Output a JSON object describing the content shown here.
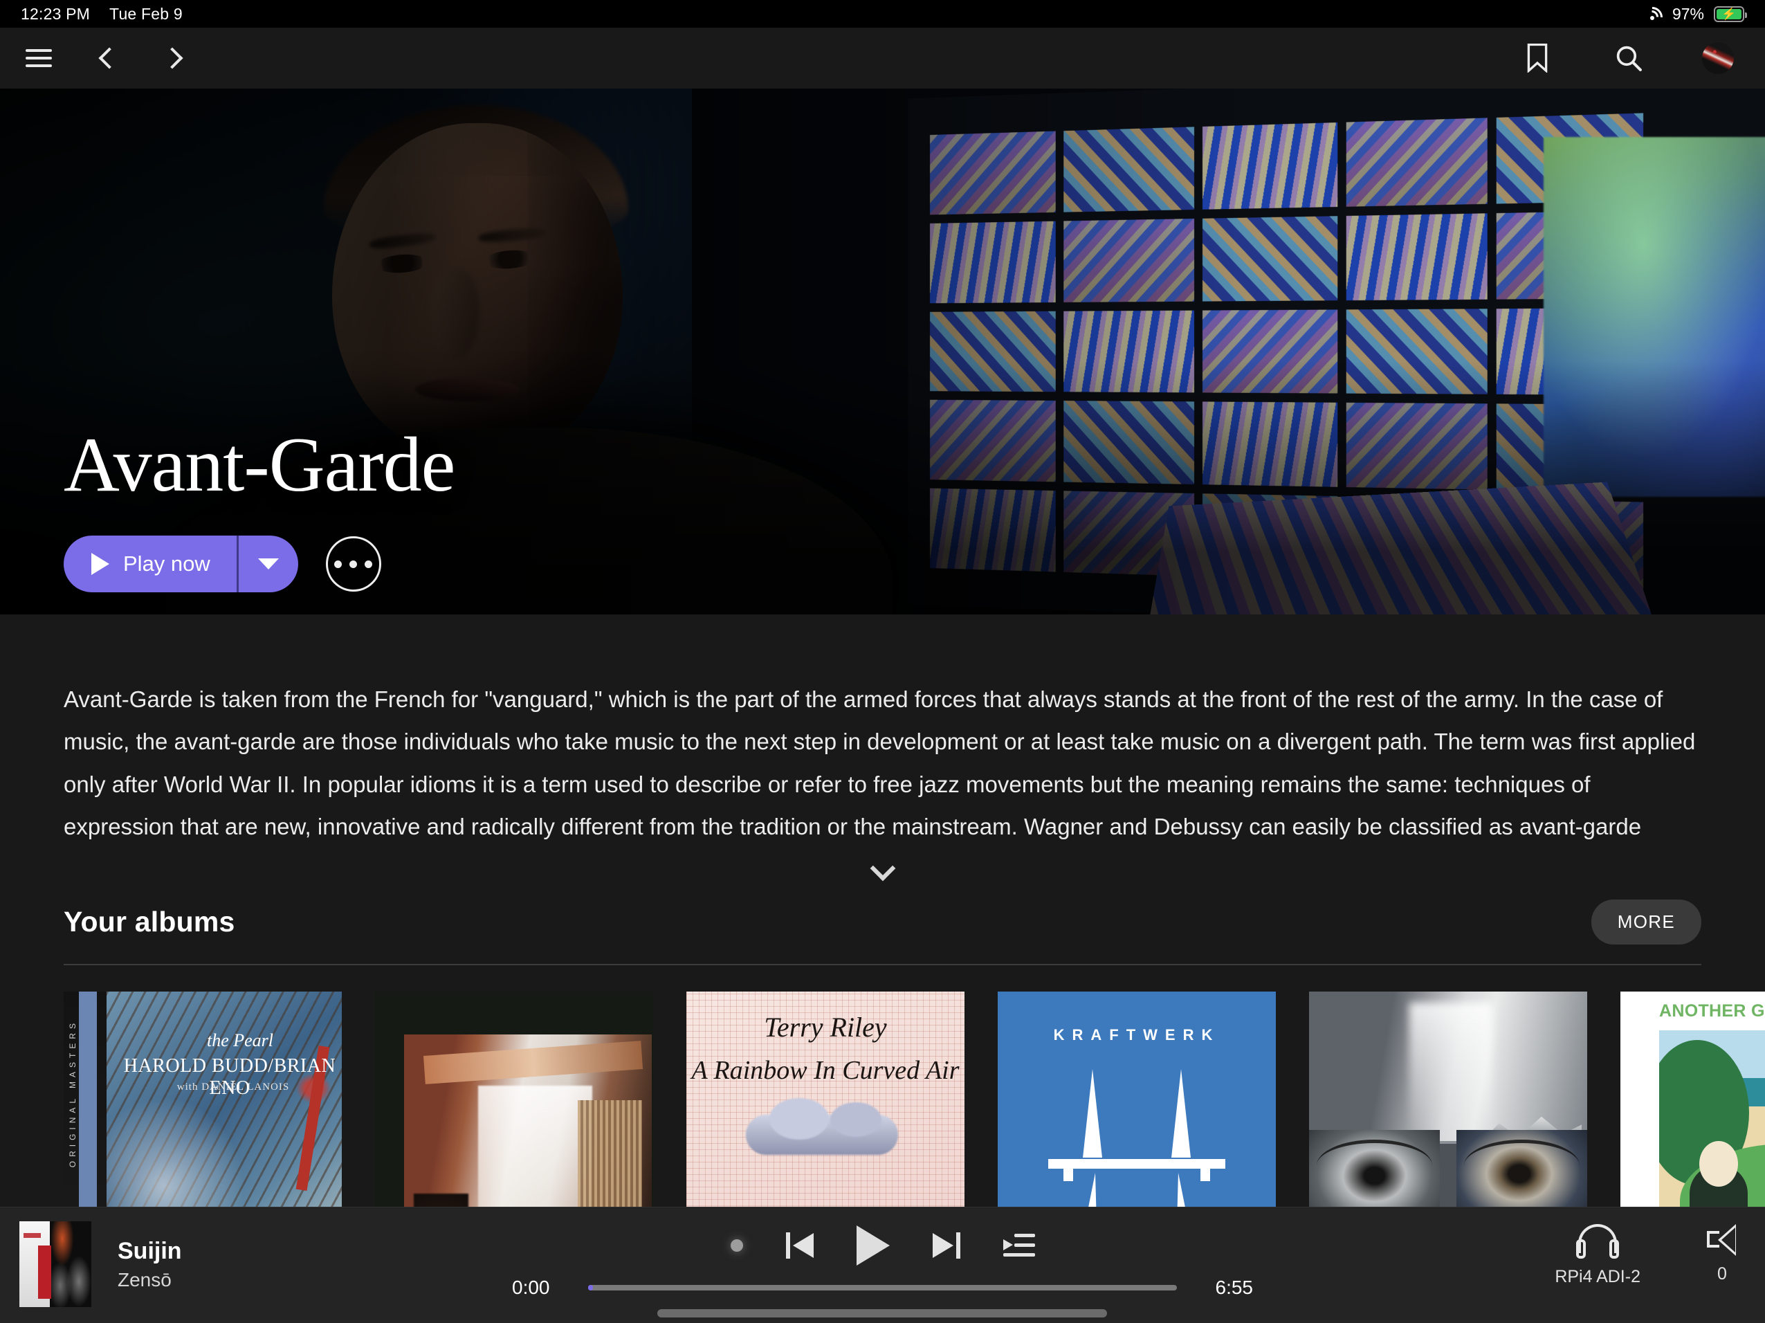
{
  "status_bar": {
    "time": "12:23 PM",
    "date": "Tue Feb 9",
    "battery_percent": "97%",
    "wifi_icon": "wifi-icon",
    "battery_icon": "battery-charging-icon"
  },
  "top_nav": {
    "menu_icon": "hamburger-menu-icon",
    "back_icon": "chevron-left-icon",
    "forward_icon": "chevron-right-icon",
    "bookmark_icon": "bookmark-icon",
    "search_icon": "search-icon",
    "avatar_icon": "user-avatar"
  },
  "hero": {
    "title": "Avant-Garde",
    "play_label": "Play now",
    "play_icon": "play-triangle-icon",
    "dropdown_icon": "caret-down-icon",
    "more_options_icon": "ellipsis-icon"
  },
  "description": {
    "text": "Avant-Garde is taken from the French for \"vanguard,\" which is the part of the armed forces that always stands at the front of the rest of the army. In the case of music, the avant-garde are those individuals who take music to the next step in development or at least take music on a divergent path. The term was first applied only after World War II. In popular idioms it is a term used to describe or refer to free jazz movements but the meaning remains the same: techniques of expression that are new, innovative and radically different from the tradition or the mainstream. Wagner and Debussy can easily be classified as avant-garde relevant to their time but the term did not enter",
    "expand_icon": "chevron-down-icon"
  },
  "albums_section": {
    "title": "Your albums",
    "more_label": "MORE",
    "albums": [
      {
        "cover_name": "album-cover-the-pearl",
        "strip_text": "ORIGINAL MASTERS",
        "line1": "the Pearl",
        "line2": "HAROLD BUDD/BRIAN ENO",
        "line3": "with DANIEL LANOIS"
      },
      {
        "cover_name": "album-cover-studio-photo"
      },
      {
        "cover_name": "album-cover-a-rainbow-in-curved-air",
        "line1": "Terry Riley",
        "line2": "A Rainbow In Curved Air"
      },
      {
        "cover_name": "album-cover-kraftwerk-autobahn",
        "line1": "KRAFTWERK"
      },
      {
        "cover_name": "album-cover-eyes"
      },
      {
        "cover_name": "album-cover-another-green-world",
        "line1": "ANOTHER GREEN WORLD"
      }
    ]
  },
  "player": {
    "now_playing": {
      "title": "Suijin",
      "artist": "Zensō",
      "art_name": "now-playing-album-art"
    },
    "controls": {
      "indicator_icon": "loading-dot-indicator",
      "previous_icon": "skip-previous-icon",
      "play_icon": "play-icon",
      "next_icon": "skip-next-icon",
      "queue_icon": "play-queue-icon"
    },
    "progress": {
      "elapsed": "0:00",
      "duration": "6:55"
    },
    "outputs": {
      "zone_icon": "headphones-icon",
      "zone_label": "RPi4 ADI-2",
      "volume_icon": "speaker-icon",
      "volume_value": "0"
    }
  },
  "colors": {
    "accent": "#7b6ce8",
    "app_bg": "#191919",
    "player_bg": "#242424",
    "more_btn_bg": "#3a3a3a"
  }
}
